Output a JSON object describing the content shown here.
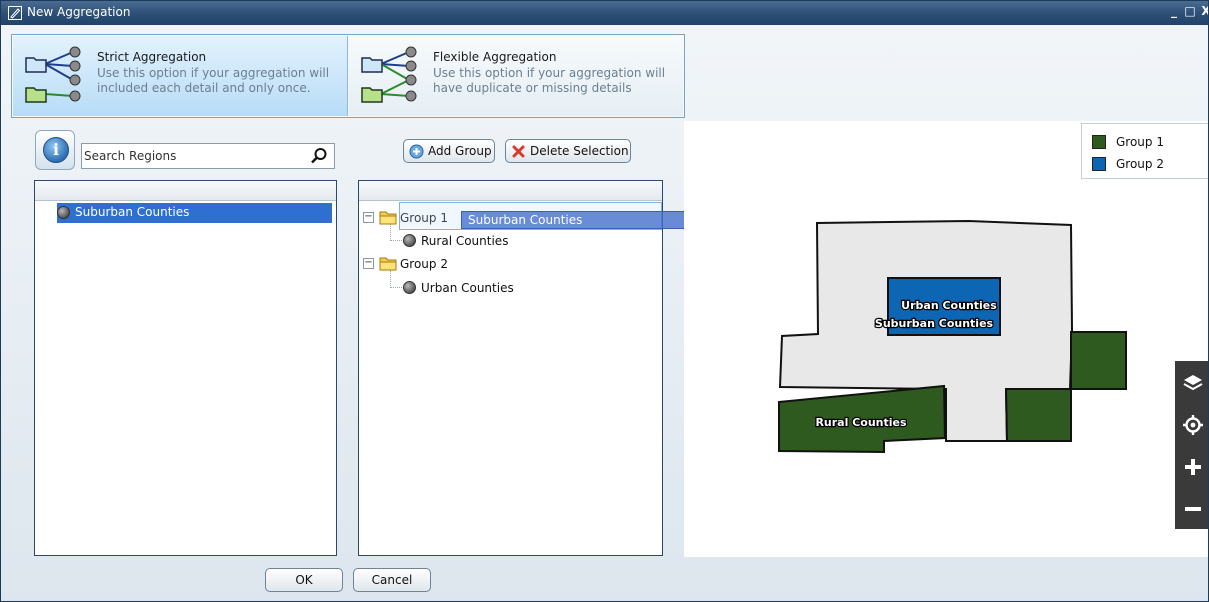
{
  "window": {
    "title": "New Aggregation",
    "minimize_glyph": "_",
    "maximize_glyph": "□",
    "close_glyph": "X"
  },
  "options": {
    "strict": {
      "title": "Strict Aggregation",
      "description": "Use this option if your aggregation will included each detail and only once.",
      "icon": "strict-aggregation-icon",
      "selected": true
    },
    "flexible": {
      "title": "Flexible Aggregation",
      "description": "Use this option if your aggregation will have duplicate or missing details",
      "icon": "flexible-aggregation-icon",
      "selected": false
    }
  },
  "regions_panel": {
    "search_placeholder": "Search Regions",
    "items": [
      {
        "label": "Suburban Counties",
        "selected": true
      }
    ]
  },
  "groups_panel": {
    "add_group_label": "Add Group",
    "delete_selection_label": "Delete Selection",
    "groups": [
      {
        "label": "Group 1",
        "expanded": true,
        "children": [
          "Rural Counties"
        ]
      },
      {
        "label": "Group 2",
        "expanded": true,
        "children": [
          "Urban Counties"
        ]
      }
    ],
    "drag_ghost_label": "Suburban Counties"
  },
  "map": {
    "legend": [
      {
        "label": "Group 1",
        "color": "#2f5a1f"
      },
      {
        "label": "Group 2",
        "color": "#0c66b3"
      }
    ],
    "labels": {
      "urban": "Urban Counties",
      "suburban": "Suburban Counties",
      "rural": "Rural Counties"
    },
    "colors": {
      "unassigned": "#e8e8e8",
      "group1": "#2f5a1f",
      "group2": "#0c66b3"
    },
    "tools": [
      "layers-icon",
      "locate-icon",
      "zoom-in-icon",
      "zoom-out-icon"
    ]
  },
  "footer": {
    "ok_label": "OK",
    "cancel_label": "Cancel"
  }
}
